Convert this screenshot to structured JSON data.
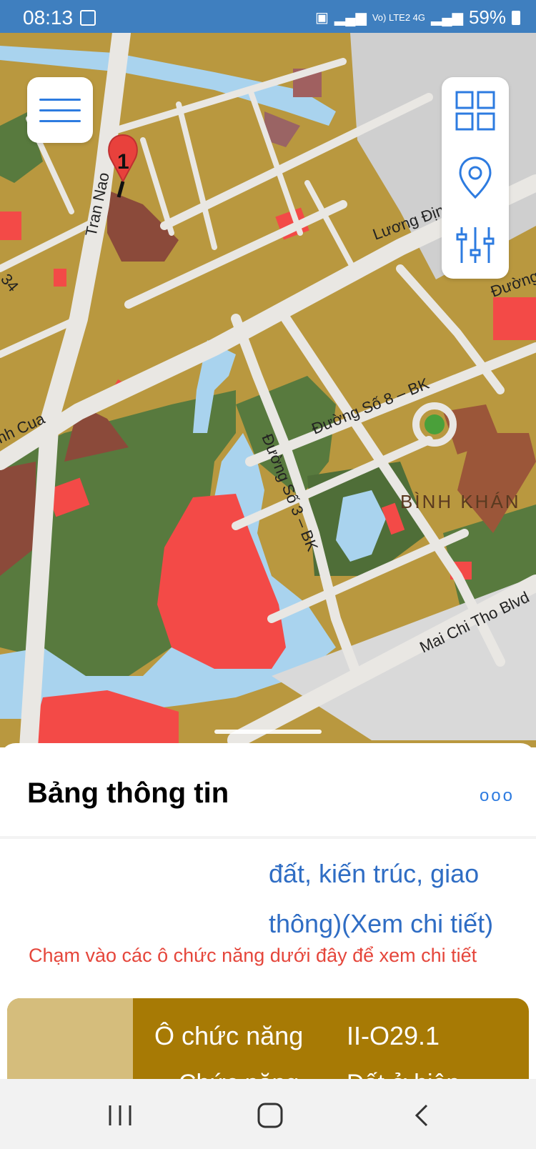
{
  "status_bar": {
    "time": "08:13",
    "network": "Vo) LTE2 4G",
    "battery": "59%"
  },
  "map": {
    "labels": {
      "tran_nao": "Tran Nao",
      "luong_dinh": "Lương Định",
      "duong_right": "Đường",
      "num_34": "34",
      "nh_cua": "nh Cua",
      "duong_so_8": "Đường Số 8 – BK",
      "duong_so_3": "Đường Số 3 – BK",
      "binh_khanh": "BÌNH KHÁN",
      "mai_chi_tho": "Mai Chi Tho Blvd"
    },
    "marker_number": "1",
    "colors": {
      "residential": "#b9983f",
      "green": "#587a3e",
      "water": "#a9d3ee",
      "red": "#f34a47",
      "brown": "#8b4a3a",
      "road": "#e9e7e3"
    }
  },
  "map_controls": {
    "menu_icon": "hamburger-menu-icon",
    "tool_icons": [
      "layers-grid-icon",
      "location-pin-icon",
      "sliders-icon"
    ]
  },
  "info_sheet": {
    "title": "Bảng thông tin",
    "more_label": "ooo",
    "description_line1": "đất, kiến trúc, giao",
    "description_line2": "thông)(Xem chi tiết)",
    "hint": "Chạm vào các ô chức năng dưới đây để xem chi tiết",
    "card": {
      "label": "Ô chức năng",
      "value": "II-O29.1",
      "label2": "Chức năng",
      "value2": "Đất ở hiện"
    }
  },
  "nav_bar": {
    "icons": [
      "recent-apps-icon",
      "home-icon",
      "back-icon"
    ]
  }
}
